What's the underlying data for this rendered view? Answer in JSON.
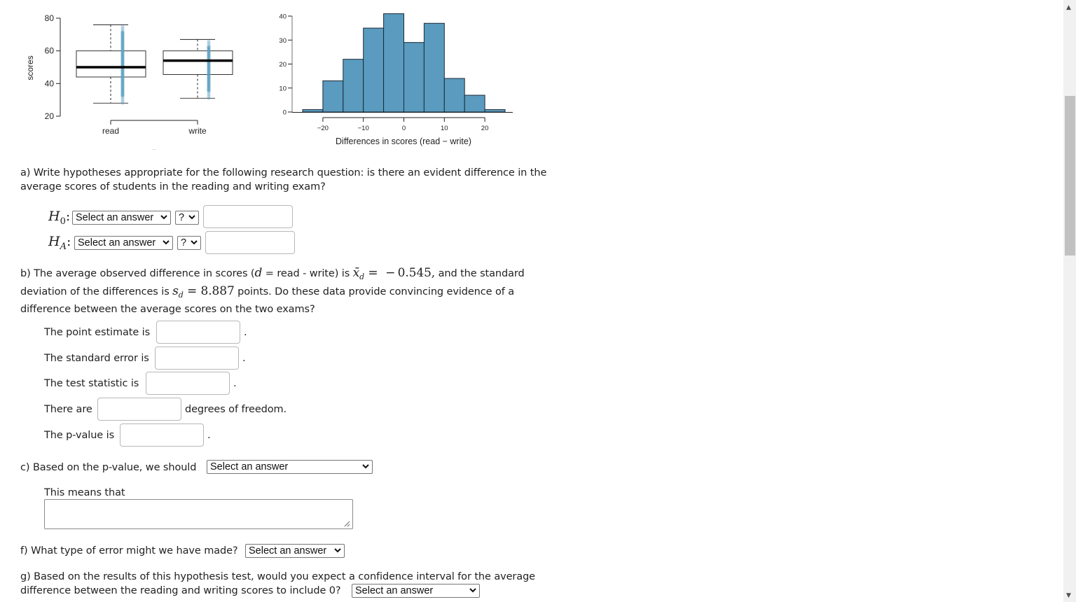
{
  "boxplot": {
    "ylabel": "scores",
    "yticks": [
      "20",
      "40",
      "60",
      "80"
    ],
    "categories": [
      "read",
      "write"
    ],
    "colors": {
      "points": "#5a9fc2",
      "median": "#000000"
    },
    "groups": [
      {
        "name": "read",
        "min": 28,
        "q1": 44,
        "median": 50,
        "q3": 60,
        "max": 76
      },
      {
        "name": "write",
        "min": 31,
        "q1": 45.5,
        "median": 54,
        "q3": 60,
        "max": 67
      }
    ]
  },
  "chart_data": {
    "type": "bar",
    "title": "",
    "xlabel": "Differences in scores (read − write)",
    "ylabel": "",
    "bin_edges": [
      -25,
      -20,
      -15,
      -10,
      -5,
      0,
      5,
      10,
      15,
      20,
      25
    ],
    "categories": [
      "-25 to -20",
      "-20 to -15",
      "-15 to -10",
      "-10 to -5",
      "-5 to 0",
      "0 to 5",
      "5 to 10",
      "10 to 15",
      "15 to 20",
      "20 to 25"
    ],
    "values": [
      1,
      13,
      22,
      35,
      41,
      29,
      37,
      14,
      7,
      1
    ],
    "xticks": [
      "−20",
      "−10",
      "0",
      "10",
      "20"
    ],
    "xtick_values": [
      -20,
      -10,
      0,
      10,
      20
    ],
    "yticks": [
      "0",
      "10",
      "20",
      "30",
      "40"
    ],
    "ylim": [
      0,
      41
    ],
    "xlim": [
      -25,
      25
    ],
    "grid": false,
    "bar_color": "#5a9bbf"
  },
  "part_a": {
    "prompt_line1": "a) Write hypotheses appropriate for the following research question: is there an evident difference in the",
    "prompt_line2": "average scores of students in the reading and writing exam?",
    "h0_label": "H",
    "h0_sub": "0",
    "ha_label": "H",
    "ha_sub": "A",
    "colon": ":",
    "h0_select": "Select an answer",
    "h0_op": "?",
    "h0_value": "",
    "ha_select": "Select an answer",
    "ha_op": "?",
    "ha_value": ""
  },
  "part_b": {
    "t1": "b) The average observed difference in scores (",
    "d": "d",
    "t2": " = read - write) is ",
    "xbar": "x̄",
    "dsub": "d",
    "eq1": " =  − 0.545,",
    "t3": "  and the standard",
    "t4": "deviation of the differences is ",
    "s": "s",
    "ssub": "d",
    "eq2": " = 8.887",
    "t5": " points. Do these data provide convincing evidence of a",
    "t6": "difference between the average scores on the two exams?",
    "point_estimate_label": "The point estimate is",
    "standard_error_label": "The standard error is",
    "test_statistic_label": "The test statistic is",
    "df_prefix": "There are",
    "df_suffix": "degrees of freedom.",
    "pvalue_label": "The p-value is",
    "period": ".",
    "point_estimate_value": "",
    "standard_error_value": "",
    "test_statistic_value": "",
    "df_value": "",
    "pvalue_value": ""
  },
  "part_c": {
    "prompt": "c)  Based on the p-value, we should",
    "select": "Select an answer",
    "means_label": "This means that",
    "means_value": ""
  },
  "part_f": {
    "prompt": "f) What type of error might we have made?",
    "select": "Select an answer"
  },
  "part_g": {
    "line1": "g) Based on the results of this hypothesis test, would you expect a confidence interval for the average",
    "line2": "difference between the reading and writing scores to include 0?",
    "select": "Select an answer"
  },
  "scrollbar": {
    "up": "▲",
    "down": "▼"
  }
}
